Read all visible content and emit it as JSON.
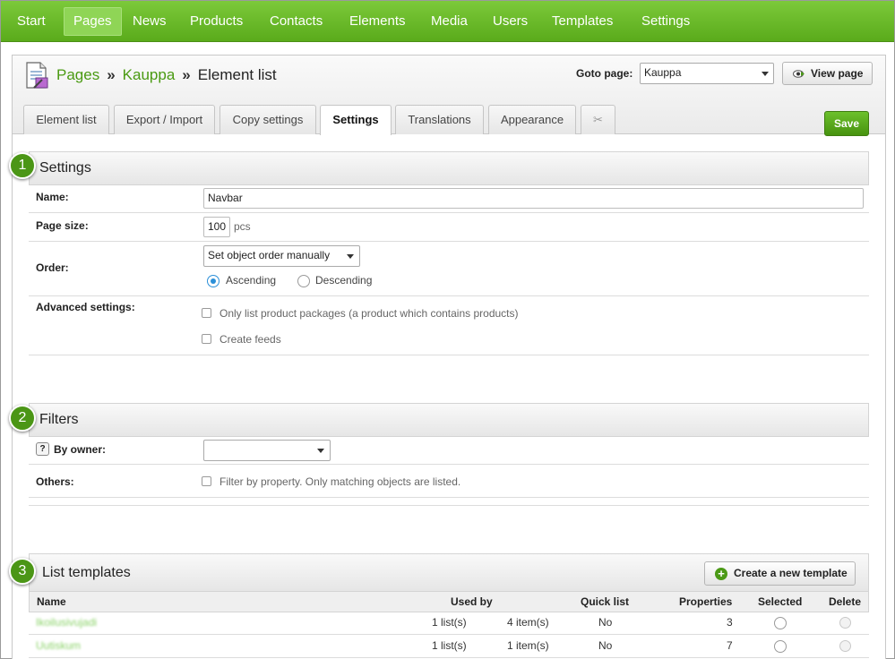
{
  "nav": {
    "items": [
      "Start",
      "Pages",
      "News",
      "Products",
      "Contacts",
      "Elements",
      "Media",
      "Users",
      "Templates",
      "Settings"
    ],
    "active": "Pages"
  },
  "breadcrumb": {
    "items": [
      "Pages",
      "Kauppa"
    ],
    "current": "Element list",
    "separator": "»"
  },
  "goto": {
    "label": "Goto page:",
    "value": "Kauppa"
  },
  "view_page_label": "View page",
  "tabs": [
    "Element list",
    "Export / Import",
    "Copy settings",
    "Settings",
    "Translations",
    "Appearance"
  ],
  "active_tab": "Settings",
  "save_label": "Save",
  "settings": {
    "step": "1",
    "title": "Settings",
    "name_label": "Name:",
    "name_value": "Navbar",
    "page_size_label": "Page size:",
    "page_size_value": "100",
    "page_size_unit": "pcs",
    "order_label": "Order:",
    "order_value": "Set object order manually",
    "ascending_label": "Ascending",
    "descending_label": "Descending",
    "order_direction": "Ascending",
    "advanced_label": "Advanced settings:",
    "only_packages_label": "Only list product packages (a product which contains products)",
    "create_feeds_label": "Create feeds"
  },
  "filters": {
    "step": "2",
    "title": "Filters",
    "owner_label": "By owner:",
    "owner_value": "",
    "others_label": "Others:",
    "filter_property_label": "Filter by property. Only matching objects are listed."
  },
  "templates": {
    "step": "3",
    "title": "List templates",
    "create_label": "Create a new template",
    "columns": {
      "name": "Name",
      "used_by": "Used by",
      "quick_list": "Quick list",
      "properties": "Properties",
      "selected": "Selected",
      "delete": "Delete"
    },
    "rows": [
      {
        "name": "Ikoilusivujadi",
        "used_lists": "1 list(s)",
        "used_items": "4 item(s)",
        "quick_list": "No",
        "properties": "3"
      },
      {
        "name": "Uutiskum",
        "used_lists": "1 list(s)",
        "used_items": "1 item(s)",
        "quick_list": "No",
        "properties": "7"
      }
    ]
  },
  "colors": {
    "nav_green": "#5aab1b",
    "link_green": "#4a9a12",
    "accent_blue": "#2b8fd8",
    "step_green": "#4b9616"
  }
}
